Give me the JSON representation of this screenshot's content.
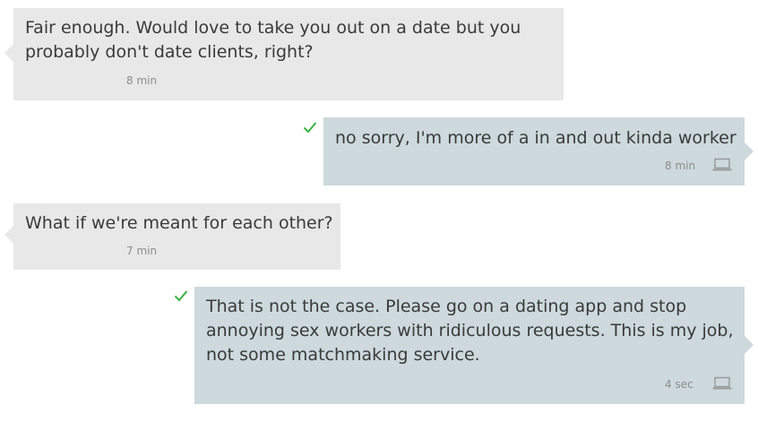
{
  "messages": [
    {
      "direction": "incoming",
      "lines": [
        "Fair enough. Would love to take you out on a date but you",
        "probably don't date clients, right?"
      ],
      "time": "8 min"
    },
    {
      "direction": "outgoing",
      "lines": [
        "no sorry, I'm more of a in and out kinda worker"
      ],
      "time": "8 min",
      "status_icon": "check-icon",
      "device_icon": "laptop-icon"
    },
    {
      "direction": "incoming",
      "lines": [
        "What if we're meant for each other?"
      ],
      "time": "7 min"
    },
    {
      "direction": "outgoing",
      "lines": [
        "That is not the case. Please go on a dating app and stop",
        "annoying sex workers with ridiculous requests. This is my job,",
        "not some matchmaking service."
      ],
      "time": "4 sec",
      "status_icon": "check-icon",
      "device_icon": "laptop-icon"
    }
  ],
  "colors": {
    "incoming_bubble": "#e8e8e8",
    "outgoing_bubble": "#cdd9dc",
    "check": "#3cb043",
    "text": "#3a3a3a",
    "time": "#8c8c8c"
  }
}
